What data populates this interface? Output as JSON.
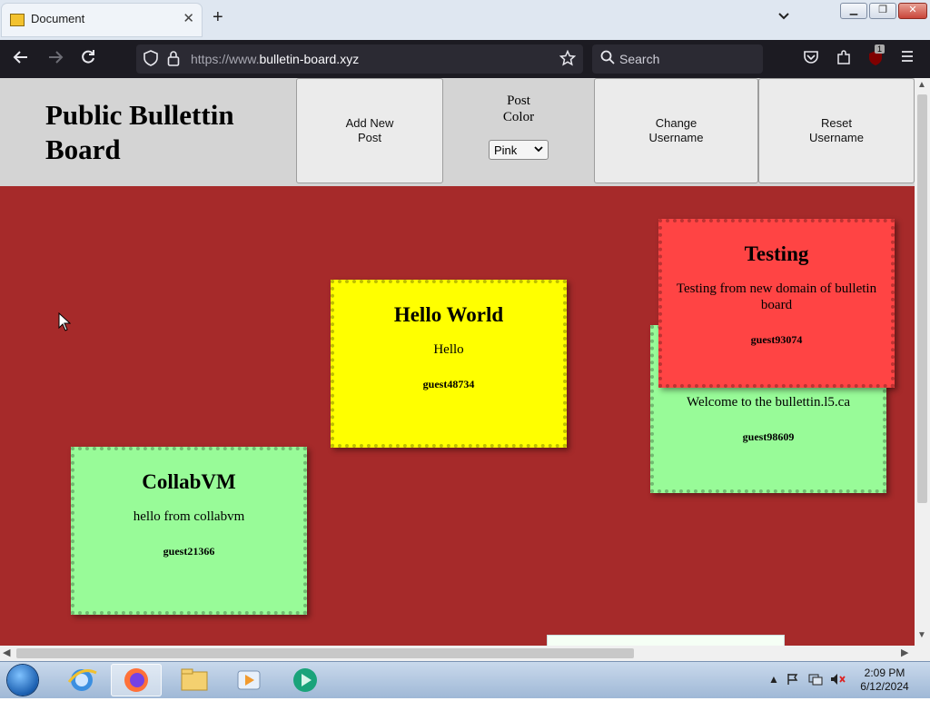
{
  "browser": {
    "tab_title": "Document",
    "url_domain": "https://www.",
    "url_host": "bulletin-board.xyz",
    "search_placeholder": "Search",
    "extension_badge": "1"
  },
  "header": {
    "site_title": "Public Bullettin Board",
    "add_post_label": "Add New Post",
    "post_color_label": "Post Color",
    "post_color_value": "Pink",
    "change_username_label": "Change Username",
    "reset_username_label": "Reset Username"
  },
  "notes": [
    {
      "title": "Hello World",
      "body": "Hello",
      "user": "guest48734",
      "color": "#ffff00"
    },
    {
      "title": "CollabVM",
      "body": "hello from collabvm",
      "user": "guest21366",
      "color": "#98fb98"
    },
    {
      "title": "",
      "body": "Welcome to the bullettin.l5.ca",
      "user": "guest98609",
      "color": "#98fb98"
    },
    {
      "title": "Testing",
      "body": "Testing from new domain of bulletin board",
      "user": "guest93074",
      "color": "#ff4444"
    }
  ],
  "taskbar": {
    "time": "2:09 PM",
    "date": "6/12/2024"
  },
  "colors": {
    "board_background": "#a62a2a",
    "header_background": "#d4d4d4"
  }
}
